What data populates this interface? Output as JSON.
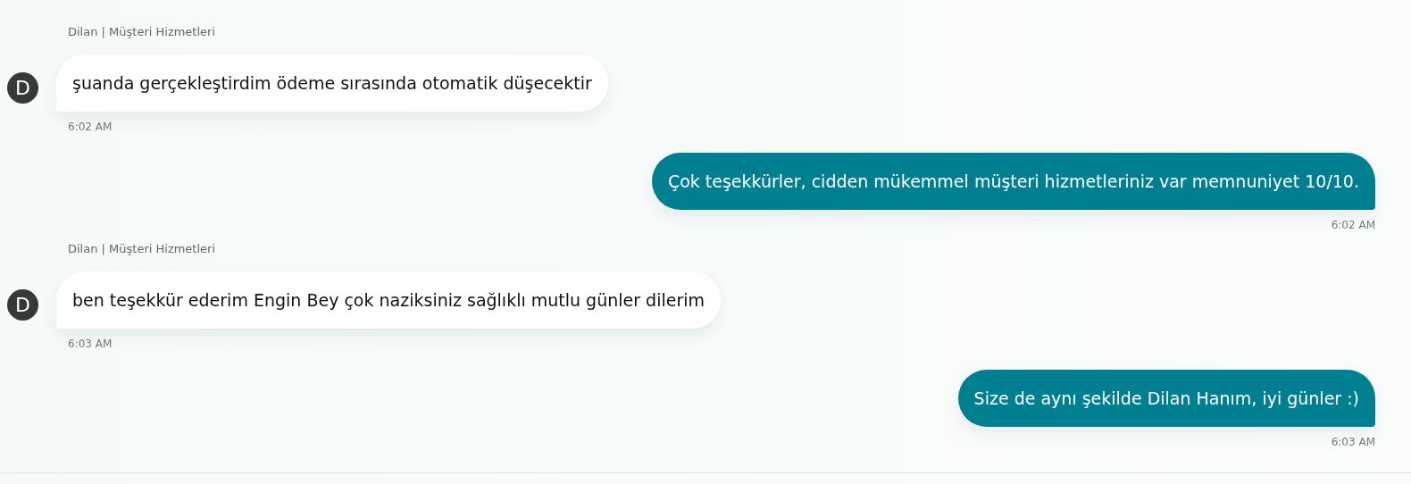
{
  "messages": [
    {
      "kind": "agent",
      "sender": "Dilan | Müşteri Hizmetleri",
      "avatar": "D",
      "text": "şuanda gerçekleştirdim ödeme sırasında otomatik düşecektir",
      "time": "6:02 AM"
    },
    {
      "kind": "user",
      "text": "Çok teşekkürler, cidden mükemmel müşteri hizmetleriniz var memnuniyet 10/10.",
      "time": "6:02 AM"
    },
    {
      "kind": "agent",
      "sender": "Dilan | Müşteri Hizmetleri",
      "avatar": "D",
      "text": "ben teşekkür ederim Engin Bey çok naziksiniz sağlıklı mutlu günler dilerim",
      "time": "6:03 AM"
    },
    {
      "kind": "user",
      "text": "Size de aynı şekilde Dilan Hanım, iyi günler :)",
      "time": "6:03 AM"
    }
  ]
}
